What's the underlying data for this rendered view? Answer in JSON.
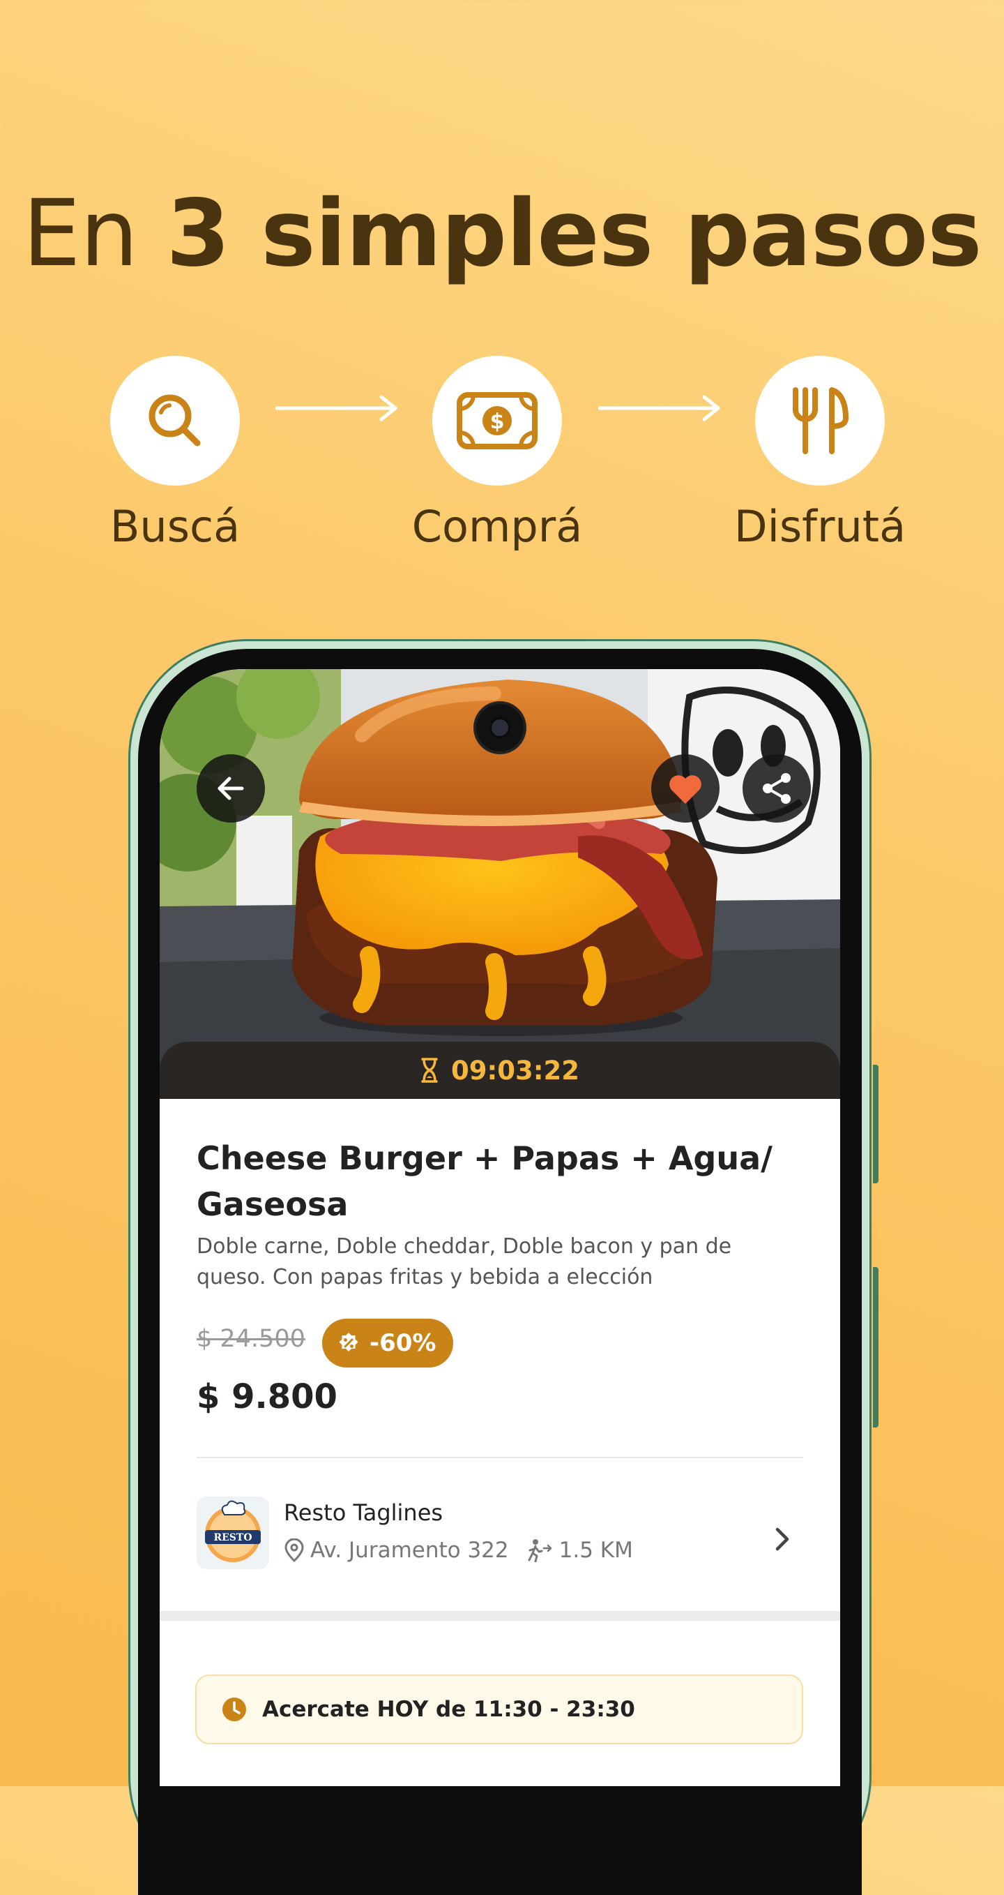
{
  "headline": {
    "light": "En ",
    "bold": "3 simples pasos"
  },
  "steps": [
    {
      "label": "Buscá",
      "icon": "search-icon"
    },
    {
      "label": "Comprá",
      "icon": "money-icon"
    },
    {
      "label": "Disfrutá",
      "icon": "cutlery-icon"
    }
  ],
  "product": {
    "timer": "09:03:22",
    "title": "Cheese Burger + Papas + Agua/ Gaseosa",
    "description": "Doble carne, Doble cheddar, Doble bacon y pan de queso. Con papas fritas y bebida a elección",
    "old_price": "$ 24.500",
    "discount": "-60%",
    "price": "$ 9.800"
  },
  "store": {
    "name": "Resto Taglines",
    "address": "Av. Juramento 322",
    "distance": "1.5 KM",
    "logo_text": "RESTO"
  },
  "pickup": {
    "text": "Acercate HOY de 11:30 - 23:30"
  },
  "colors": {
    "accent": "#c98316",
    "timer": "#f6b73c",
    "heart": "#f26a3c",
    "text_dark": "#4a340f"
  }
}
